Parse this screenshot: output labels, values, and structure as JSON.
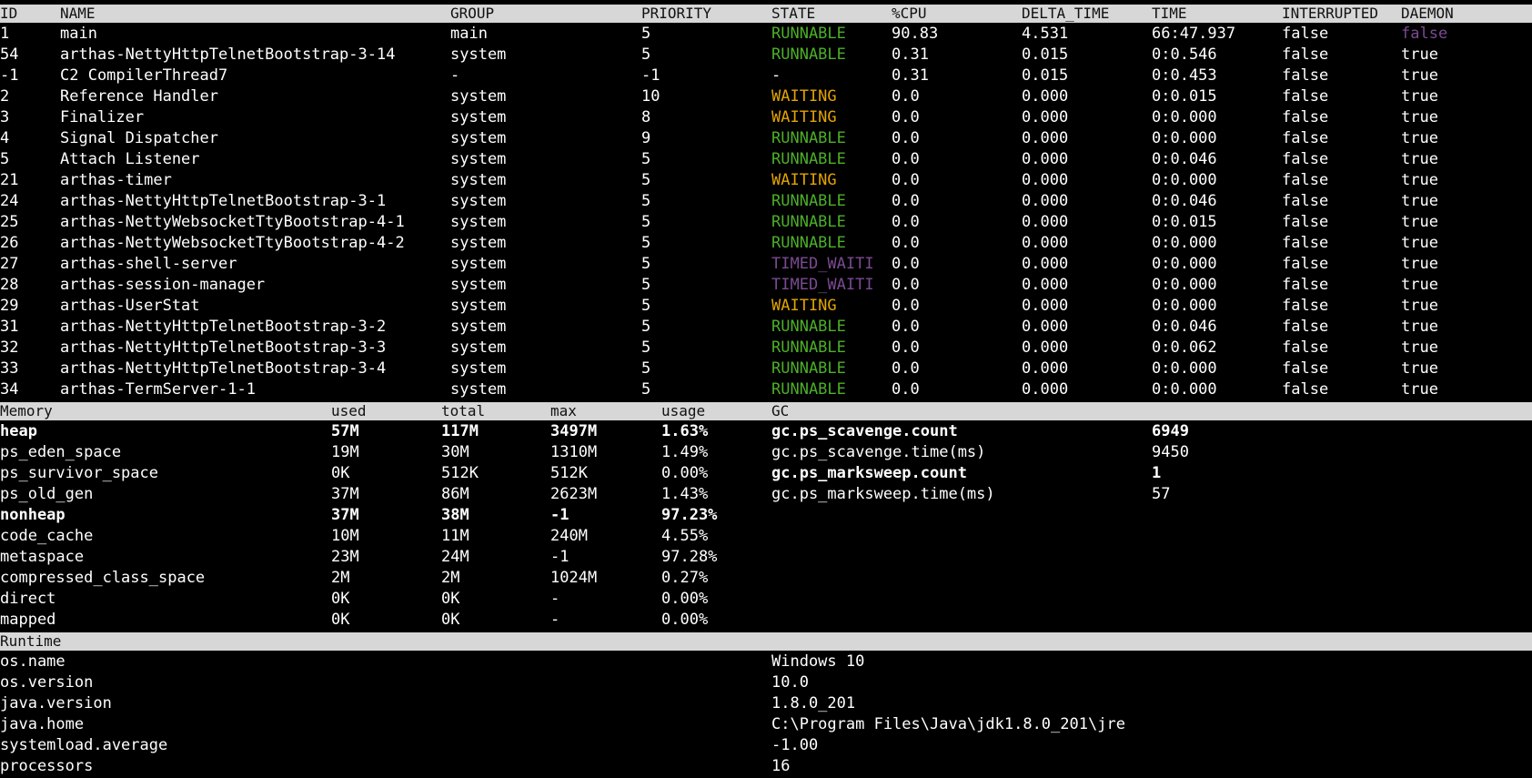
{
  "thread_table": {
    "headers": [
      "ID",
      "NAME",
      "GROUP",
      "PRIORITY",
      "STATE",
      "%CPU",
      "DELTA_TIME",
      "TIME",
      "INTERRUPTED",
      "DAEMON"
    ],
    "rows": [
      {
        "id": "1",
        "name": "main",
        "group": "main",
        "priority": "5",
        "state": "RUNNABLE",
        "cpu": "90.83",
        "delta": "4.531",
        "time": "66:47.937",
        "interrupted": "false",
        "daemon": "false"
      },
      {
        "id": "54",
        "name": "arthas-NettyHttpTelnetBootstrap-3-14",
        "group": "system",
        "priority": "5",
        "state": "RUNNABLE",
        "cpu": "0.31",
        "delta": "0.015",
        "time": "0:0.546",
        "interrupted": "false",
        "daemon": "true"
      },
      {
        "id": "-1",
        "name": "C2 CompilerThread7",
        "group": "-",
        "priority": "-1",
        "state": "-",
        "cpu": "0.31",
        "delta": "0.015",
        "time": "0:0.453",
        "interrupted": "false",
        "daemon": "true"
      },
      {
        "id": "2",
        "name": "Reference Handler",
        "group": "system",
        "priority": "10",
        "state": "WAITING",
        "cpu": "0.0",
        "delta": "0.000",
        "time": "0:0.015",
        "interrupted": "false",
        "daemon": "true"
      },
      {
        "id": "3",
        "name": "Finalizer",
        "group": "system",
        "priority": "8",
        "state": "WAITING",
        "cpu": "0.0",
        "delta": "0.000",
        "time": "0:0.000",
        "interrupted": "false",
        "daemon": "true"
      },
      {
        "id": "4",
        "name": "Signal Dispatcher",
        "group": "system",
        "priority": "9",
        "state": "RUNNABLE",
        "cpu": "0.0",
        "delta": "0.000",
        "time": "0:0.000",
        "interrupted": "false",
        "daemon": "true"
      },
      {
        "id": "5",
        "name": "Attach Listener",
        "group": "system",
        "priority": "5",
        "state": "RUNNABLE",
        "cpu": "0.0",
        "delta": "0.000",
        "time": "0:0.046",
        "interrupted": "false",
        "daemon": "true"
      },
      {
        "id": "21",
        "name": "arthas-timer",
        "group": "system",
        "priority": "5",
        "state": "WAITING",
        "cpu": "0.0",
        "delta": "0.000",
        "time": "0:0.000",
        "interrupted": "false",
        "daemon": "true"
      },
      {
        "id": "24",
        "name": "arthas-NettyHttpTelnetBootstrap-3-1",
        "group": "system",
        "priority": "5",
        "state": "RUNNABLE",
        "cpu": "0.0",
        "delta": "0.000",
        "time": "0:0.046",
        "interrupted": "false",
        "daemon": "true"
      },
      {
        "id": "25",
        "name": "arthas-NettyWebsocketTtyBootstrap-4-1",
        "group": "system",
        "priority": "5",
        "state": "RUNNABLE",
        "cpu": "0.0",
        "delta": "0.000",
        "time": "0:0.015",
        "interrupted": "false",
        "daemon": "true"
      },
      {
        "id": "26",
        "name": "arthas-NettyWebsocketTtyBootstrap-4-2",
        "group": "system",
        "priority": "5",
        "state": "RUNNABLE",
        "cpu": "0.0",
        "delta": "0.000",
        "time": "0:0.000",
        "interrupted": "false",
        "daemon": "true"
      },
      {
        "id": "27",
        "name": "arthas-shell-server",
        "group": "system",
        "priority": "5",
        "state": "TIMED_WAITI",
        "cpu": "0.0",
        "delta": "0.000",
        "time": "0:0.000",
        "interrupted": "false",
        "daemon": "true"
      },
      {
        "id": "28",
        "name": "arthas-session-manager",
        "group": "system",
        "priority": "5",
        "state": "TIMED_WAITI",
        "cpu": "0.0",
        "delta": "0.000",
        "time": "0:0.000",
        "interrupted": "false",
        "daemon": "true"
      },
      {
        "id": "29",
        "name": "arthas-UserStat",
        "group": "system",
        "priority": "5",
        "state": "WAITING",
        "cpu": "0.0",
        "delta": "0.000",
        "time": "0:0.000",
        "interrupted": "false",
        "daemon": "true"
      },
      {
        "id": "31",
        "name": "arthas-NettyHttpTelnetBootstrap-3-2",
        "group": "system",
        "priority": "5",
        "state": "RUNNABLE",
        "cpu": "0.0",
        "delta": "0.000",
        "time": "0:0.046",
        "interrupted": "false",
        "daemon": "true"
      },
      {
        "id": "32",
        "name": "arthas-NettyHttpTelnetBootstrap-3-3",
        "group": "system",
        "priority": "5",
        "state": "RUNNABLE",
        "cpu": "0.0",
        "delta": "0.000",
        "time": "0:0.062",
        "interrupted": "false",
        "daemon": "true"
      },
      {
        "id": "33",
        "name": "arthas-NettyHttpTelnetBootstrap-3-4",
        "group": "system",
        "priority": "5",
        "state": "RUNNABLE",
        "cpu": "0.0",
        "delta": "0.000",
        "time": "0:0.000",
        "interrupted": "false",
        "daemon": "true"
      },
      {
        "id": "34",
        "name": "arthas-TermServer-1-1",
        "group": "system",
        "priority": "5",
        "state": "RUNNABLE",
        "cpu": "0.0",
        "delta": "0.000",
        "time": "0:0.000",
        "interrupted": "false",
        "daemon": "true"
      }
    ]
  },
  "memory_table": {
    "headers": [
      "Memory",
      "used",
      "total",
      "max",
      "usage"
    ],
    "rows": [
      {
        "name": "heap",
        "used": "57M",
        "total": "117M",
        "max": "3497M",
        "usage": "1.63%",
        "bold": true
      },
      {
        "name": "ps_eden_space",
        "used": "19M",
        "total": "30M",
        "max": "1310M",
        "usage": "1.49%",
        "bold": false
      },
      {
        "name": "ps_survivor_space",
        "used": "0K",
        "total": "512K",
        "max": "512K",
        "usage": "0.00%",
        "bold": false
      },
      {
        "name": "ps_old_gen",
        "used": "37M",
        "total": "86M",
        "max": "2623M",
        "usage": "1.43%",
        "bold": false
      },
      {
        "name": "nonheap",
        "used": "37M",
        "total": "38M",
        "max": "-1",
        "usage": "97.23%",
        "bold": true
      },
      {
        "name": "code_cache",
        "used": "10M",
        "total": "11M",
        "max": "240M",
        "usage": "4.55%",
        "bold": false
      },
      {
        "name": "metaspace",
        "used": "23M",
        "total": "24M",
        "max": "-1",
        "usage": "97.28%",
        "bold": false
      },
      {
        "name": "compressed_class_space",
        "used": "2M",
        "total": "2M",
        "max": "1024M",
        "usage": "0.27%",
        "bold": false
      },
      {
        "name": "direct",
        "used": "0K",
        "total": "0K",
        "max": "-",
        "usage": "0.00%",
        "bold": false
      },
      {
        "name": "mapped",
        "used": "0K",
        "total": "0K",
        "max": "-",
        "usage": "0.00%",
        "bold": false
      }
    ]
  },
  "gc_table": {
    "header": "GC",
    "rows": [
      {
        "name": "gc.ps_scavenge.count",
        "value": "6949",
        "bold": true
      },
      {
        "name": "gc.ps_scavenge.time(ms)",
        "value": "9450",
        "bold": false
      },
      {
        "name": "gc.ps_marksweep.count",
        "value": "1",
        "bold": true
      },
      {
        "name": "gc.ps_marksweep.time(ms)",
        "value": "57",
        "bold": false
      }
    ]
  },
  "runtime_table": {
    "header": "Runtime",
    "rows": [
      {
        "name": "os.name",
        "value": "Windows 10"
      },
      {
        "name": "os.version",
        "value": "10.0"
      },
      {
        "name": "java.version",
        "value": "1.8.0_201"
      },
      {
        "name": "java.home",
        "value": "C:\\Program Files\\Java\\jdk1.8.0_201\\jre"
      },
      {
        "name": "systemload.average",
        "value": "-1.00"
      },
      {
        "name": "processors",
        "value": "16"
      }
    ]
  },
  "colors": {
    "background": "#000000",
    "header_bg": "#d7d7d7",
    "runnable": "#4caf27",
    "waiting": "#e3a400",
    "timed_waiting": "#7b4a92",
    "text": "#ffffff"
  }
}
